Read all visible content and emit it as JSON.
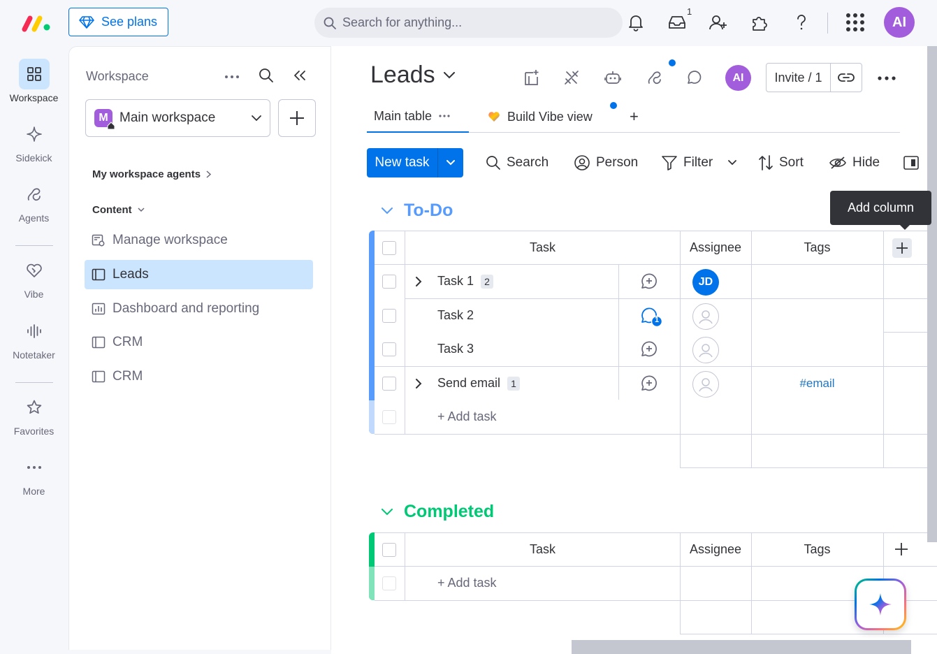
{
  "topbar": {
    "see_plans": "See plans",
    "search_placeholder": "Search for anything...",
    "inbox_count": "1",
    "user_initials": "AI",
    "icons": [
      "bell-icon",
      "inbox-icon",
      "invite-person-icon",
      "integrations-puzzle-icon",
      "help-icon",
      "apps-grid-icon"
    ]
  },
  "rail": {
    "items": [
      {
        "label": "Workspace",
        "icon": "workspace-grid-icon",
        "active": true
      },
      {
        "label": "Sidekick",
        "icon": "sidekick-sparkle-icon"
      },
      {
        "label": "Agents",
        "icon": "agents-icon"
      },
      {
        "label": "Vibe",
        "icon": "vibe-heart-icon"
      },
      {
        "label": "Notetaker",
        "icon": "notetaker-waveform-icon"
      },
      {
        "label": "Favorites",
        "icon": "star-icon"
      },
      {
        "label": "More",
        "icon": "more-dots-icon"
      }
    ]
  },
  "workspace_panel": {
    "title": "Workspace",
    "workspace_name": "Main workspace",
    "workspace_initial": "M",
    "agents_section": "My workspace agents",
    "content_section": "Content",
    "items": [
      {
        "label": "Manage workspace",
        "icon": "manage-workspace-icon"
      },
      {
        "label": "Leads",
        "icon": "board-icon",
        "active": true
      },
      {
        "label": "Dashboard and reporting",
        "icon": "dashboard-icon"
      },
      {
        "label": "CRM",
        "icon": "board-icon"
      },
      {
        "label": "CRM",
        "icon": "board-icon"
      }
    ]
  },
  "board": {
    "title": "Leads",
    "user_initials": "AI",
    "invite_label": "Invite / 1",
    "tabs": [
      {
        "label": "Main table",
        "active": true
      },
      {
        "label": "Build Vibe view"
      }
    ],
    "add_tab": "+",
    "toolbar": {
      "new_task": "New task",
      "search": "Search",
      "person": "Person",
      "filter": "Filter",
      "sort": "Sort",
      "hide": "Hide"
    },
    "tooltip": "Add column",
    "groups": [
      {
        "title": "To-Do",
        "color": "#579bfc",
        "columns": [
          "Task",
          "Assignee",
          "Tags"
        ],
        "rows": [
          {
            "task": "Task 1",
            "subitems": "2",
            "expandable": true,
            "assignee": "JD",
            "tag": "",
            "updates": ""
          },
          {
            "task": "Task 2",
            "subitems": "",
            "expandable": false,
            "assignee": "",
            "tag": "",
            "updates": "1"
          },
          {
            "task": "Task 3",
            "subitems": "",
            "expandable": false,
            "assignee": "",
            "tag": "",
            "updates": ""
          },
          {
            "task": "Send email",
            "subitems": "1",
            "expandable": true,
            "assignee": "",
            "tag": "#email",
            "updates": ""
          }
        ],
        "add_task": "+ Add task"
      },
      {
        "title": "Completed",
        "color": "#00c875",
        "columns": [
          "Task",
          "Assignee",
          "Tags"
        ],
        "rows": [],
        "add_task": "+ Add task"
      }
    ]
  }
}
